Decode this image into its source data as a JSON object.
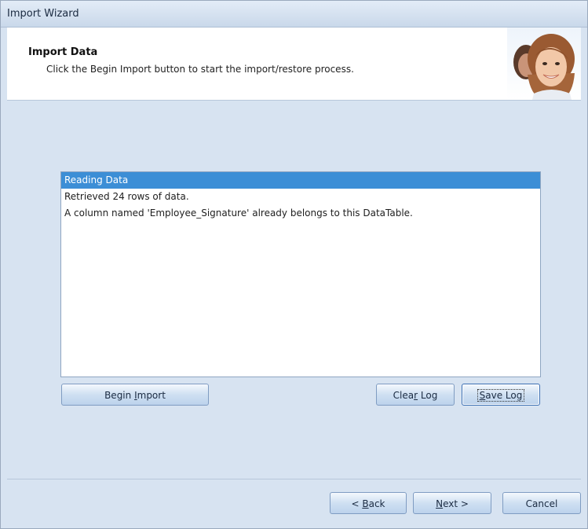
{
  "window": {
    "title": "Import Wizard"
  },
  "header": {
    "title": "Import Data",
    "description": "Click the Begin Import button to start the import/restore process.",
    "image_icon": "wizard-portrait"
  },
  "log": {
    "rows": [
      "Reading Data",
      "Retrieved 24 rows of data.",
      "A column named 'Employee_Signature' already belongs to this DataTable."
    ],
    "selected_index": 0
  },
  "buttons": {
    "begin_import": {
      "pre": "Begin ",
      "ul": "I",
      "post": "mport"
    },
    "clear_log": {
      "pre": "Clea",
      "ul": "r",
      "post": " Log"
    },
    "save_log": {
      "pre": "",
      "ul": "S",
      "post": "ave Log"
    },
    "back": {
      "pre": "< ",
      "ul": "B",
      "post": "ack"
    },
    "next": {
      "pre": "",
      "ul": "N",
      "post": "ext >"
    },
    "cancel": {
      "pre": "Cancel",
      "ul": "",
      "post": ""
    }
  },
  "colors": {
    "accent": "#3c8ed6",
    "panel": "#d7e3f1",
    "button": "#cfe0f2"
  }
}
